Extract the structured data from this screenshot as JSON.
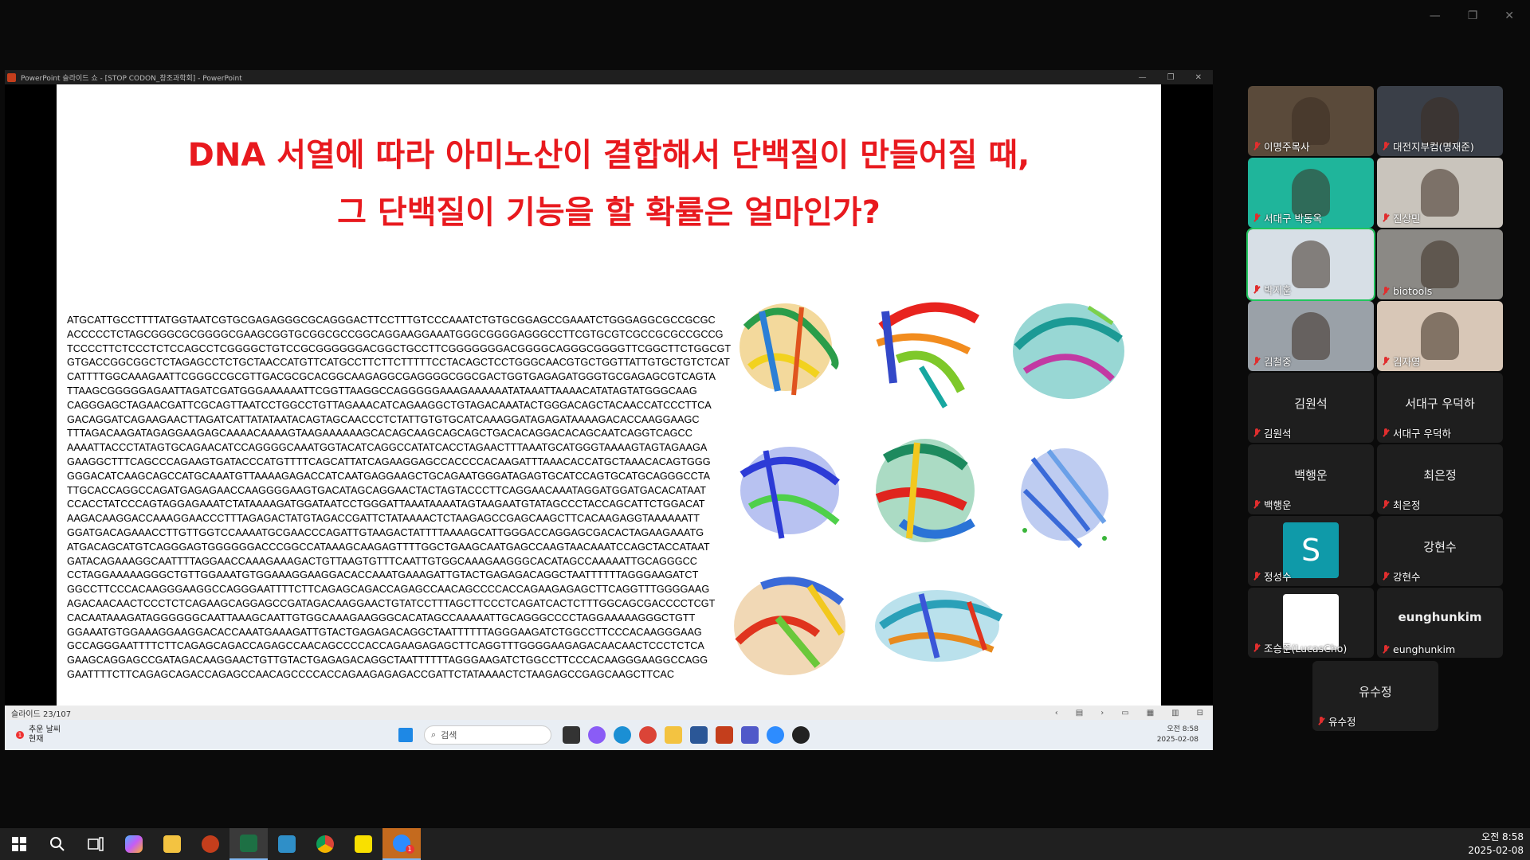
{
  "ppt": {
    "window_title": "PowerPoint 슬라이드 쇼 - [STOP CODON_창조과학회] - PowerPoint",
    "slide_title_1": "DNA 서열에 따라 아미노산이 결합해서 단백질이 만들어질 때,",
    "slide_title_2": "그 단백질이 기능을 할 확률은 얼마인가?",
    "dna_lines": [
      "ATGCATTGCCTTTTATGGTAATCGTGCGAGAGGGCGCAGGGACTTCCTTTGTCCCAAATCTGTGCGGAGCCGAAATCTGGGAGGCGCCGCGC",
      "ACCCCCTCTAGCGGGCGCGGGGCGAAGCGGTGCGGCGCCGGCAGGAAGGAAATGGGCGGGGAGGGCCTTCGTGCGTCGCCGCGCCGCCG",
      "TCCCCTTCTCCCTCTCCAGCCTCGGGGCTGTCCGCGGGGGGACGGCTGCCTTCGGGGGGGACGGGGCAGGGCGGGGTTCGGCTTCTGGCGT",
      "GTGACCGGCGGCTCTAGAGCCTCTGCTAACCATGTTCATGCCTTCTTCTTTTTCCTACAGCTCCTGGGCAACGTGCTGGTTATTGTGCTGTCTCAT",
      "CATTTTGGCAAAGAATTCGGGCCGCGTTGACGCGCACGGCAAGAGGCGAGGGGCGGCGACTGGTGAGAGATGGGTGCGAGAGCGTCAGTA",
      "TTAAGCGGGGGAGAATTAGATCGATGGGAAAAAATTCGGTTAAGGCCAGGGGGAAAGAAAAAATATAAATTAAAACATATAGTATGGGCAAG",
      "CAGGGAGCTAGAACGATTCGCAGTTAATCCTGGCCTGTTAGAAACATCAGAAGGCTGTAGACAAATACTGGGACAGCTACAACCATCCCTTCA",
      "GACAGGATCAGAAGAACTTAGATCATTATATAATACAGTAGCAACCCTCTATTGTGTGCATCAAAGGATAGAGATAAAAGACACCAAGGAAGC",
      "TTTAGACAAGATAGAGGAAGAGCAAAACAAAAGTAAGAAAAAAGCACAGCAAGCAGCAGCTGACACAGGACACAGCAATCAGGTCAGCC",
      "AAAATTACCCTATAGTGCAGAACATCCAGGGGCAAATGGTACATCAGGCCATATCACCTAGAACTTTAAATGCATGGGTAAAAGTAGTAGAAGA",
      "GAAGGCTTTCAGCCCAGAAGTGATACCCATGTTTTCAGCATTATCAGAAGGAGCCACCCCACAAGATTTAAACACCATGCTAAACACAGTGGG",
      "GGGACATCAAGCAGCCATGCAAATGTTAAAAGAGACCATCAATGAGGAAGCTGCAGAATGGGATAGAGTGCATCCAGTGCATGCAGGGCCTA",
      "TTGCACCAGGCCAGATGAGAGAACCAAGGGGAAGTGACATAGCAGGAACTACTAGTACCCTTCAGGAACAAATAGGATGGATGACACATAAT",
      "CCACCTATCCCAGTAGGAGAAATCTATAAAAGATGGATAATCCTGGGATTAAATAAAATAGTAAGAATGTATAGCCCTACCAGCATTCTGGACAT",
      "AAGACAAGGACCAAAGGAACCCTTTAGAGACTATGTAGACCGATTCTATAAAACTCTAAGAGCCGAGCAAGCTTCACAAGAGGTAAAAAATT",
      "GGATGACAGAAACCTTGTTGGTCCAAAATGCGAACCCAGATTGTAAGACTATTTTAAAAGCATTGGGACCAGGAGCGACACTAGAAGAAATG",
      "ATGACAGCATGTCAGGGAGTGGGGGGACCCGGCCATAAAGCAAGAGTTTTGGCTGAAGCAATGAGCCAAGTAACAAATCCAGCTACCATAAT",
      "GATACAGAAAGGCAATTTTAGGAACCAAAGAAAGACTGTTAAGTGTTTCAATTGTGGCAAAGAAGGGCACATAGCCAAAAATTGCAGGGCC",
      "CCTAGGAAAAAGGGCTGTTGGAAATGTGGAAAGGAAGGACACCAAATGAAAGATTGTACTGAGAGACAGGCTAATTTTTTAGGGAAGATCT",
      "GGCCTTCCCACAAGGGAAGGCCAGGGAATTTTCTTCAGAGCAGACCAGAGCCAACAGCCCCACCAGAAGAGAGCTTCAGGTTTGGGGAAG",
      "AGACAACAACTCCCTCTCAGAAGCAGGAGCCGATAGACAAGGAACTGTATCCTTTAGCTTCCCTCAGATCACTCTTTGGCAGCGACCCCTCGT",
      "CACAATAAAGATAGGGGGGCAATTAAAGCAATTGTGGCAAAGAAGGGCACATAGCCAAAAATTGCAGGGCCCCTAGGAAAAAGGGCTGTT",
      "GGAAATGTGGAAAGGAAGGACACCAAATGAAAGATTGTACTGAGAGACAGGCTAATTTTTTAGGGAAGATCTGGCCTTCCCACAAGGGAAG",
      "GCCAGGGAATTTTCTTCAGAGCAGACCAGAGCCAACAGCCCCACCAGAAGAGAGCTTCAGGTTTGGGGAAGAGACAACAACTCCCTCTCA",
      "GAAGCAGGAGCCGATAGACAAGGAACTGTTGTACTGAGAGACAGGCTAATTTTTTAGGGAAGATCTGGCCTTCCCACAAGGGAAGGCCAGG",
      "GAATTTTCTTCAGAGCAGACCAGAGCCAACAGCCCCACCAGAAGAGAGACCGATTCTATAAAACTCTAAGAGCCGAGCAAGCTTCAC"
    ],
    "slide_counter": "슬라이드 23/107"
  },
  "inner_taskbar": {
    "weather_badge": "1",
    "weather_line1": "추운 날씨",
    "weather_line2": "현재",
    "search_placeholder": "검색",
    "clock_time": "오전 8:58",
    "clock_date": "2025-02-08"
  },
  "participants": [
    {
      "name": "이명주목사",
      "video": true,
      "color": "#5a4a3a"
    },
    {
      "name": "대전지부컴(명재준)",
      "video": true,
      "color": "#3a3f48"
    },
    {
      "name": "서대구 박동옥",
      "video": true,
      "color": "#1fb59b"
    },
    {
      "name": "진상민",
      "video": true,
      "color": "#c9c4bc"
    },
    {
      "name": "박지훈",
      "video": true,
      "color": "#d7dfe6",
      "active": true
    },
    {
      "name": "biotools",
      "video": true,
      "color": "#8b8985"
    },
    {
      "name": "김철중",
      "video": true,
      "color": "#9aa1a8"
    },
    {
      "name": "김자영",
      "video": true,
      "color": "#d8c7b7"
    },
    {
      "name": "김원석",
      "big": "김원석"
    },
    {
      "name": "서대구 우덕하",
      "big": "서대구 우덕하"
    },
    {
      "name": "백행운",
      "big": "백행운"
    },
    {
      "name": "최은정",
      "big": "최은정"
    },
    {
      "name": "정성수",
      "avatar_letter": "S"
    },
    {
      "name": "강현수",
      "big": "강현수"
    },
    {
      "name": "조승준(LucasCho)",
      "avatar_white": true
    },
    {
      "name": "eunghunkim",
      "big": "eunghunkim"
    },
    {
      "name": "유수정",
      "big": "유수정"
    }
  ],
  "taskbar": {
    "clock_time": "오전 8:58",
    "clock_date": "2025-02-08",
    "zoom_badge": "1"
  },
  "colors": {
    "title_red": "#e8191e",
    "active_speaker": "#22c55e",
    "mute_red": "#e02e2e"
  }
}
